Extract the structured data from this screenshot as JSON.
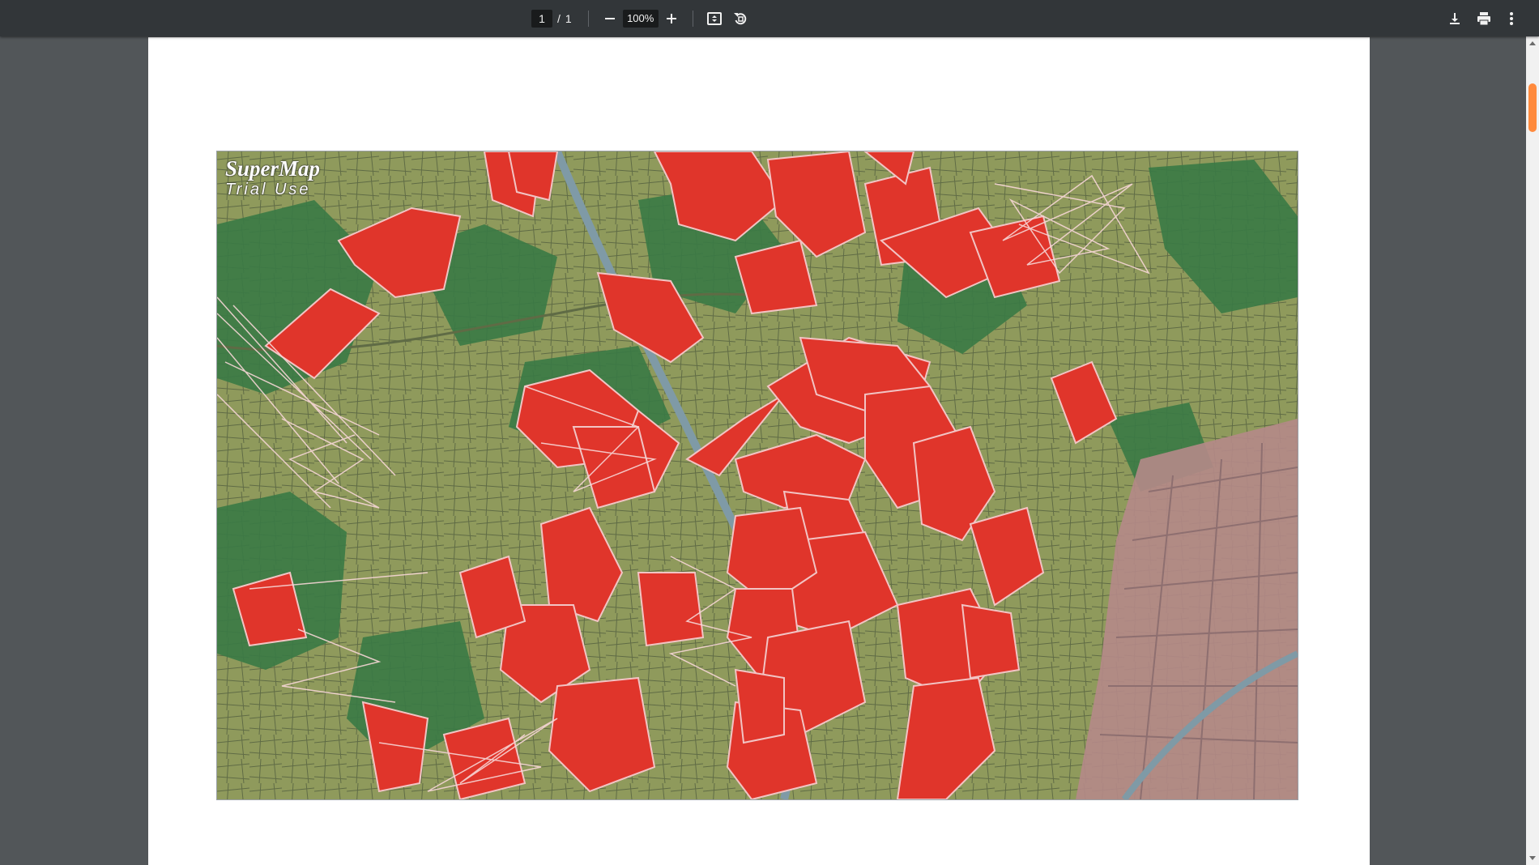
{
  "toolbar": {
    "current_page": "1",
    "page_separator": "/",
    "total_pages": "1",
    "zoom_value": "100%",
    "icons": {
      "zoom_out": "minus-icon",
      "zoom_in": "plus-icon",
      "fit": "fit-to-page-icon",
      "rotate": "rotate-counterclockwise-icon",
      "download": "download-icon",
      "print": "print-icon",
      "more": "more-vertical-icon"
    }
  },
  "document": {
    "map_image": {
      "watermark_title": "SuperMap",
      "watermark_subtitle": "Trial Use",
      "colors": {
        "base_farmland": "#8f9a5c",
        "forest": "#3a7a45",
        "urban": "#b58a88",
        "selected_polygon": "#e0352b",
        "polygon_outline": "#f2c4c4",
        "river": "#7f9aa6"
      }
    }
  },
  "colors": {
    "toolbar_bg": "#323639",
    "viewer_bg": "#525659",
    "scroll_thumb": "#ff8a3d"
  }
}
